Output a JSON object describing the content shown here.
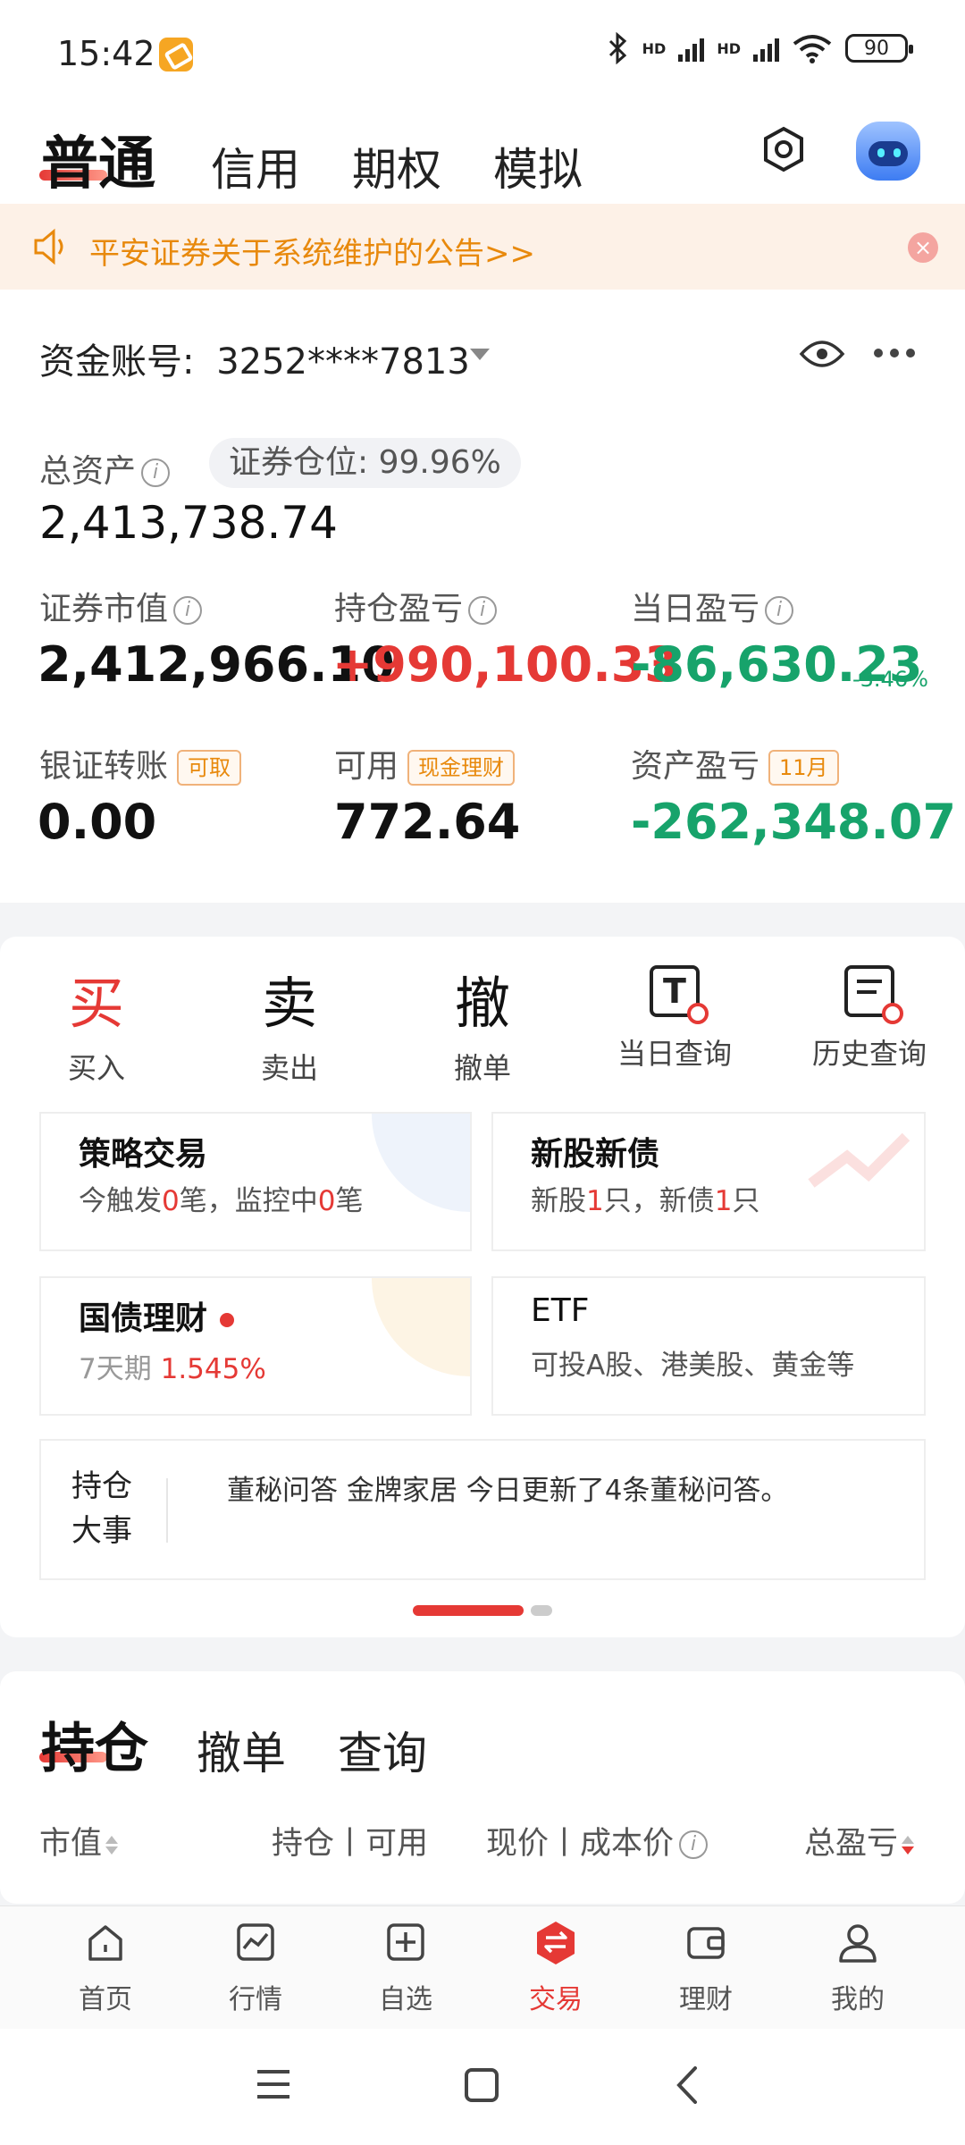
{
  "status_bar": {
    "time": "15:42",
    "network_a": "HD",
    "network_b": "HD",
    "wifi_sub": "6",
    "battery": "90"
  },
  "header": {
    "tabs": [
      {
        "label": "普通",
        "active": true
      },
      {
        "label": "信用"
      },
      {
        "label": "期权"
      },
      {
        "label": "模拟"
      }
    ]
  },
  "notice": {
    "text": "平安证券关于系统维护的公告>>"
  },
  "account": {
    "label": "资金账号:",
    "number": "3252****7813"
  },
  "summary": {
    "total_label": "总资产",
    "position_label": "证券仓位:",
    "position_value": "99.96%",
    "total_value": "2,413,738.74",
    "market_value_label": "证券市值",
    "market_value": "2,412,966.10",
    "hold_pl_label": "持仓盈亏",
    "hold_pl": "+990,100.33",
    "day_pl_label": "当日盈亏",
    "day_pl": "-86,630.23",
    "day_pl_pct": "-3.46%",
    "transfer_label": "银证转账",
    "transfer_tag": "可取",
    "transfer_value": "0.00",
    "avail_label": "可用",
    "avail_tag": "现金理财",
    "avail_value": "772.64",
    "asset_pl_label": "资产盈亏",
    "asset_pl_tag": "11月",
    "asset_pl": "-262,348.07"
  },
  "actions": [
    {
      "glyph": "买",
      "label": "买入"
    },
    {
      "glyph": "卖",
      "label": "卖出"
    },
    {
      "glyph": "撤",
      "label": "撤单"
    },
    {
      "glyph": "T",
      "label": "当日查询"
    },
    {
      "glyph": "",
      "label": "历史查询"
    }
  ],
  "features": {
    "strategy": {
      "title": "策略交易",
      "sub_a": "今触发",
      "n1": "0",
      "sub_b": "笔，监控中",
      "n2": "0",
      "sub_c": "笔"
    },
    "ipo": {
      "title": "新股新债",
      "sub_a": "新股",
      "n1": "1",
      "sub_b": "只，新债",
      "n2": "1",
      "sub_c": "只"
    },
    "bond": {
      "title": "国债理财",
      "sub_a": "7天期",
      "rate": "1.545%"
    },
    "etf": {
      "title": "ETF",
      "sub": "可投A股、港美股、黄金等"
    }
  },
  "events": {
    "title_a": "持仓",
    "title_b": "大事",
    "text": "董秘问答 金牌家居 今日更新了4条董秘问答。"
  },
  "holdings": {
    "tabs": [
      "持仓",
      "撤单",
      "查询"
    ],
    "columns": {
      "market": "市值",
      "qty": "持仓丨可用",
      "price": "现价丨成本价",
      "pl": "总盈亏"
    }
  },
  "bottom_nav": [
    {
      "label": "首页"
    },
    {
      "label": "行情"
    },
    {
      "label": "自选"
    },
    {
      "label": "交易",
      "active": true
    },
    {
      "label": "理财"
    },
    {
      "label": "我的"
    }
  ],
  "colors": {
    "accent": "#e53935",
    "gain": "#e53935",
    "loss": "#17a36b",
    "notice": "#e8890c"
  }
}
